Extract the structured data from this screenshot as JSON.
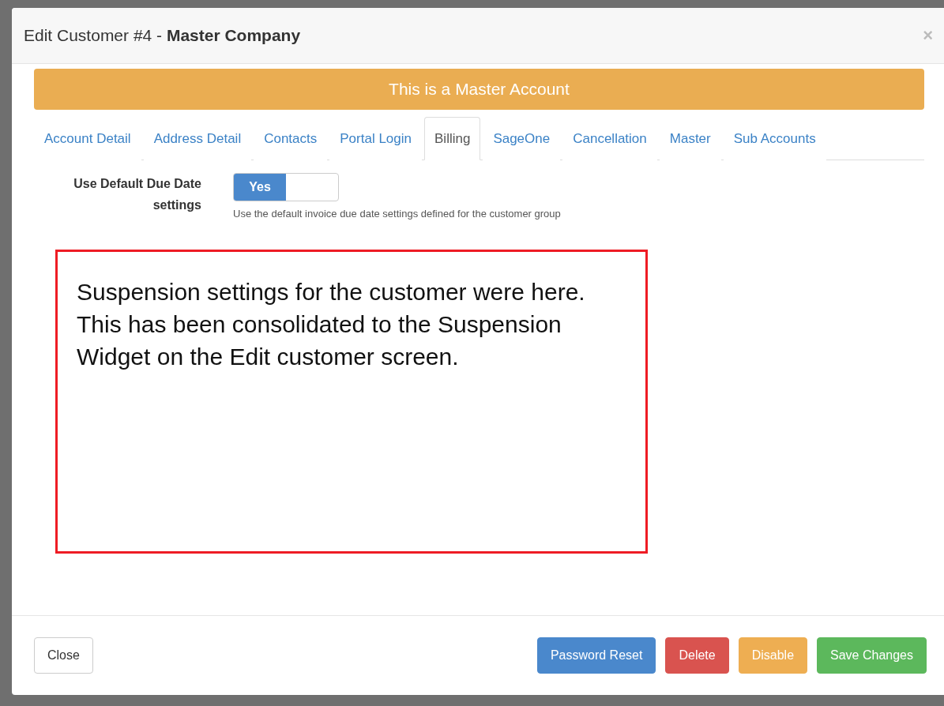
{
  "dialog": {
    "title": "Edit Customer #4 - ",
    "title_bold": "Master Company",
    "close": "×"
  },
  "banner": "This is a Master Account",
  "tabs": [
    {
      "label": "Account Detail",
      "selected": false
    },
    {
      "label": "Address Detail",
      "selected": false
    },
    {
      "label": "Contacts",
      "selected": false
    },
    {
      "label": "Portal Login",
      "selected": false
    },
    {
      "label": "Billing",
      "selected": true
    },
    {
      "label": "SageOne",
      "selected": false
    },
    {
      "label": "Cancellation",
      "selected": false
    },
    {
      "label": "Master",
      "selected": false
    },
    {
      "label": "Sub Accounts",
      "selected": false
    }
  ],
  "setting": {
    "label": "Use Default Due Date settings",
    "toggle": {
      "label": "Yes",
      "on": true
    },
    "help": "Use the default invoice due date settings defined for the customer group"
  },
  "annotation": "Suspension settings for the customer were here. This has been consolidated to the Suspension Widget on the Edit customer screen.",
  "footer": {
    "close": "Close",
    "buttons": [
      {
        "label": "Password Reset",
        "kind": "primary"
      },
      {
        "label": "Delete",
        "kind": "danger"
      },
      {
        "label": "Disable",
        "kind": "warning"
      },
      {
        "label": "Save Changes",
        "kind": "success"
      }
    ]
  }
}
